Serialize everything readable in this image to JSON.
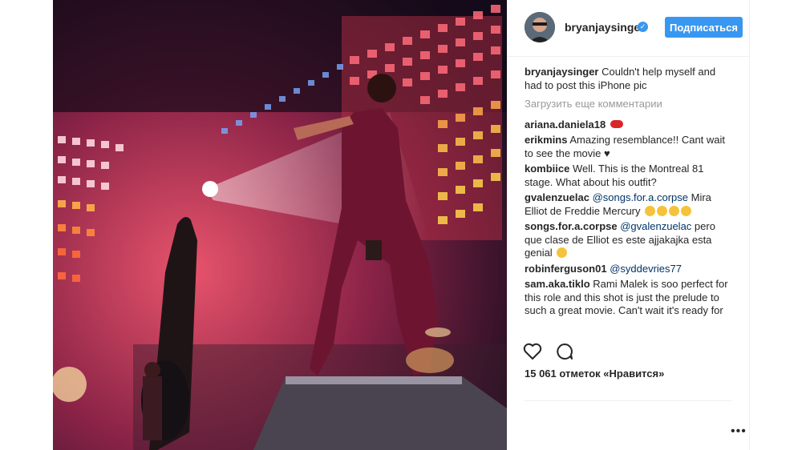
{
  "post": {
    "username": "bryanjaysinger",
    "follow_label": "Подписаться",
    "caption_user": "bryanjaysinger",
    "caption_text": " Couldn't help myself and had to post this iPhone pic",
    "load_more": "Загрузить еще комментарии",
    "likes": "15 061 отметок «Нравится»",
    "more": "•••"
  },
  "comments": [
    {
      "user": "ariana.daniela18",
      "text": " ",
      "mention": "",
      "after": ""
    },
    {
      "user": "erikmins",
      "text": " Amazing resemblance!! Cant wait to see the movie ♥",
      "mention": "",
      "after": ""
    },
    {
      "user": "kombiice",
      "text": " Well. This is the Montreal 81 stage. What about his outfit?",
      "mention": "",
      "after": ""
    },
    {
      "user": "gvalenzuelac",
      "text": " ",
      "mention": "@songs.for.a.corpse",
      "after": " Mira Elliot de Freddie Mercury"
    },
    {
      "user": "songs.for.a.corpse",
      "text": " ",
      "mention": "@gvalenzuelac",
      "after": " pero que clase de Elliot es este ajjakajka esta genial"
    },
    {
      "user": "robinferguson01",
      "text": " ",
      "mention": "@syddevries77",
      "after": ""
    },
    {
      "user": "sam.aka.tiklo",
      "text": " Rami Malek is soo perfect for this role and this shot is just the prelude to such a great movie. Can't wait it's ready for",
      "mention": "",
      "after": ""
    }
  ],
  "icons": {
    "like": "heart-icon",
    "comment": "comment-icon",
    "verified": "verified-badge-icon",
    "more": "more-options-icon"
  },
  "colors": {
    "accent": "#3897f0",
    "mention": "#003569",
    "muted": "#999999",
    "text": "#262626"
  }
}
